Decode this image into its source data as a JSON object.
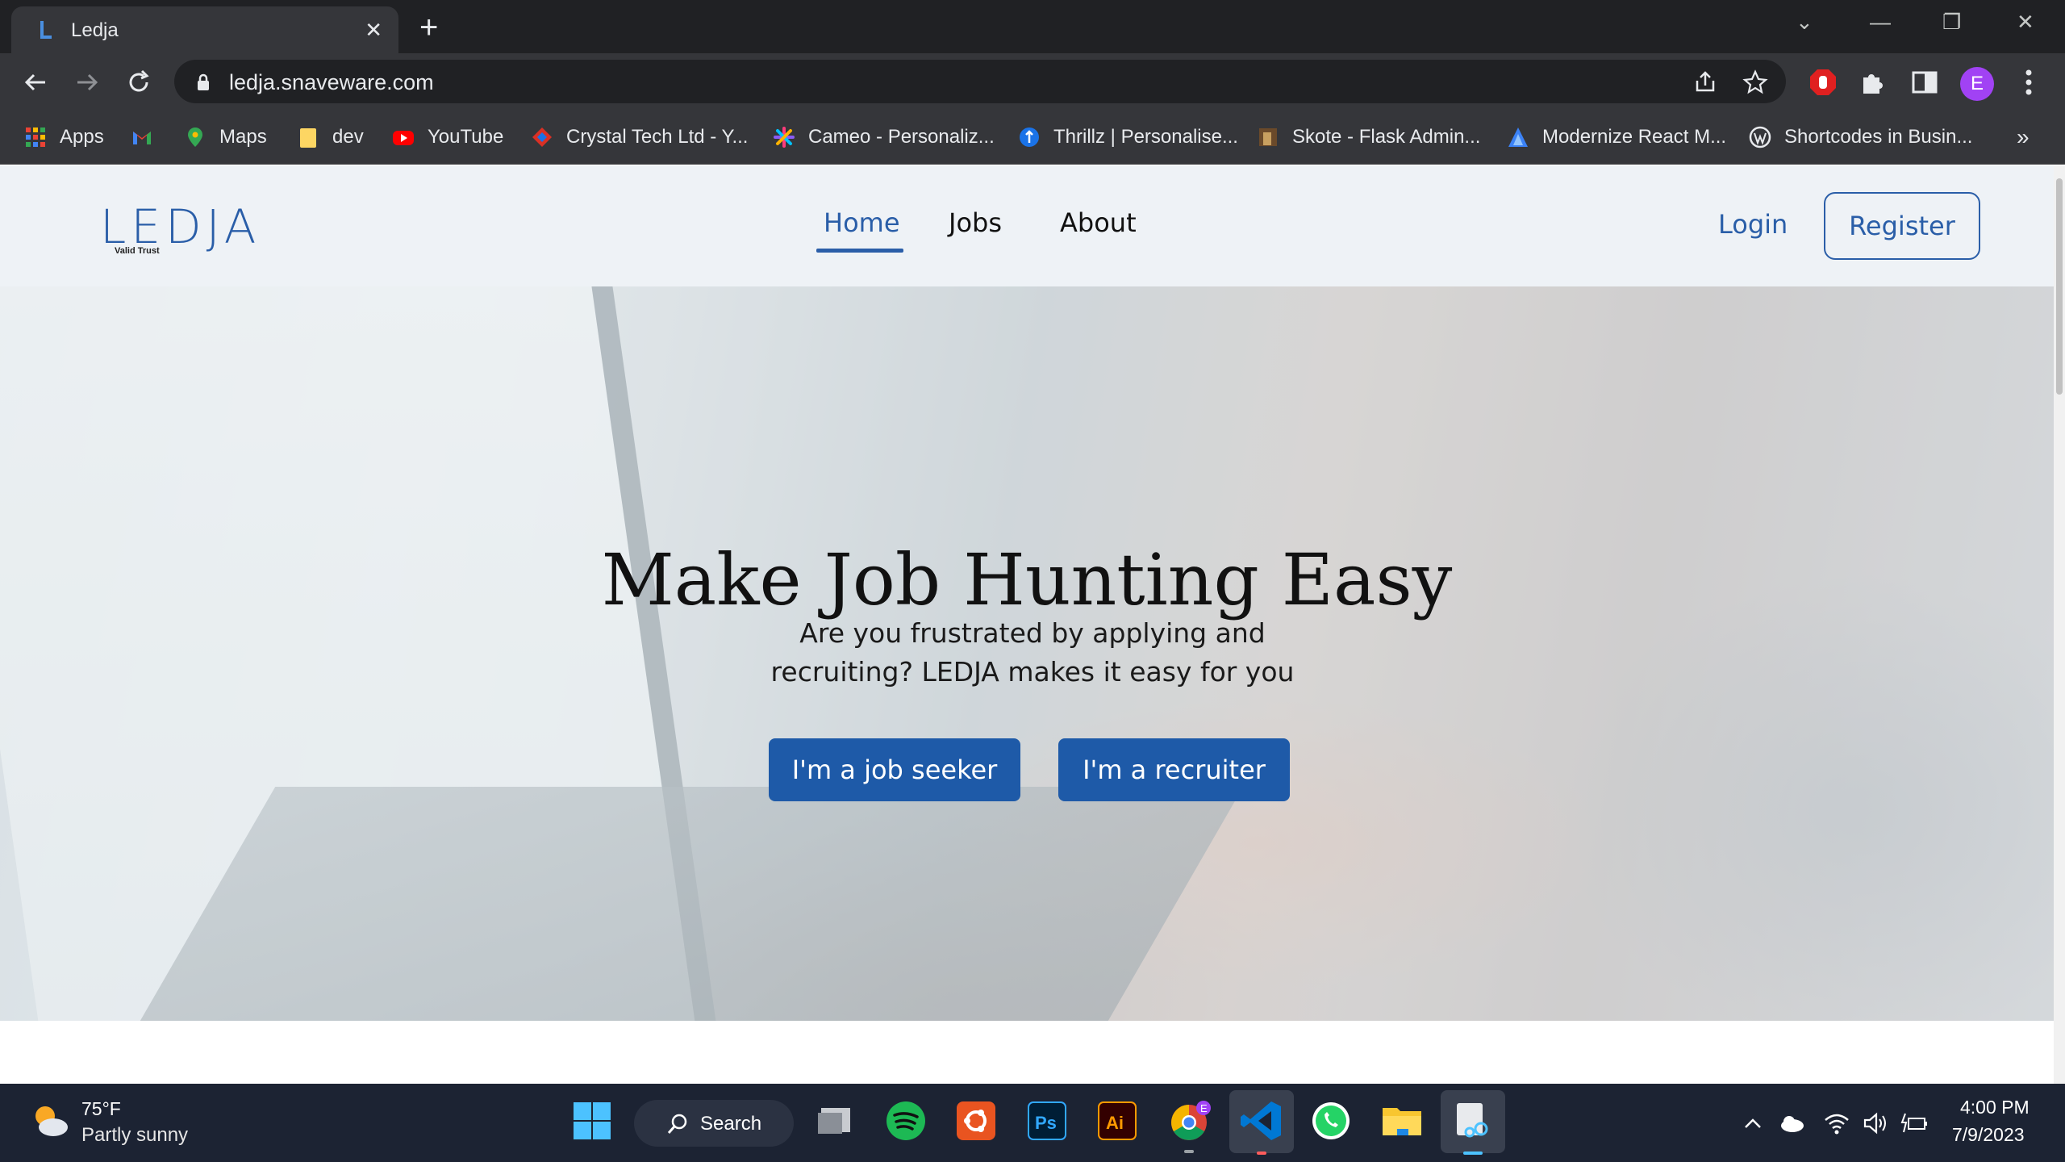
{
  "browser": {
    "tab_title": "Ledja",
    "url": "ledja.snaveware.com",
    "profile_initial": "E",
    "bookmarks": [
      {
        "label": "Apps",
        "icon": "apps-grid-icon"
      },
      {
        "label": "",
        "icon": "gmail-icon"
      },
      {
        "label": "Maps",
        "icon": "maps-icon"
      },
      {
        "label": "dev",
        "icon": "folder-icon"
      },
      {
        "label": "YouTube",
        "icon": "youtube-icon"
      },
      {
        "label": "Crystal Tech Ltd - Y...",
        "icon": "crystal-tech-icon"
      },
      {
        "label": "Cameo - Personaliz...",
        "icon": "cameo-icon"
      },
      {
        "label": "Thrillz | Personalise...",
        "icon": "thrillz-icon"
      },
      {
        "label": "Skote - Flask Admin...",
        "icon": "skote-icon"
      },
      {
        "label": "Modernize React M...",
        "icon": "modernize-icon"
      },
      {
        "label": "Shortcodes in Busin...",
        "icon": "wordpress-icon"
      }
    ],
    "more_bookmarks": "»"
  },
  "site": {
    "logo_text": "LEDJA",
    "logo_tagline": "Valid Trust",
    "nav": {
      "home": "Home",
      "jobs": "Jobs",
      "about": "About",
      "login": "Login",
      "register": "Register"
    },
    "hero": {
      "title": "Make Job Hunting Easy",
      "subtitle": "Are you frustrated by applying and recruiting? LEDJA makes it easy for you",
      "job_seeker_button": "I'm a job seeker",
      "recruiter_button": "I'm a recruiter"
    },
    "colors": {
      "brand": "#1e5aa8",
      "nav_bg": "#eef2f6"
    }
  },
  "taskbar": {
    "weather_temp": "75°F",
    "weather_desc": "Partly sunny",
    "search_label": "Search",
    "time": "4:00 PM",
    "date": "7/9/2023",
    "chrome_badge": "E"
  }
}
